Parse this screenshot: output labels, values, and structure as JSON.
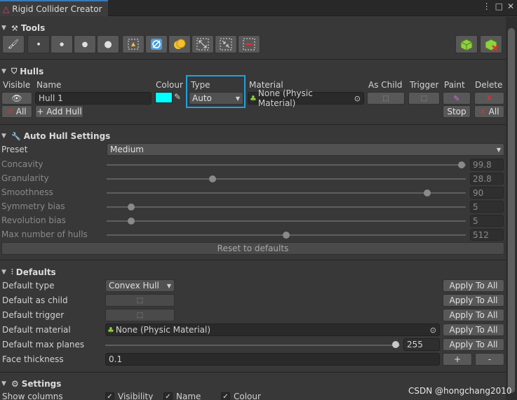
{
  "window": {
    "title": "Rigid Collider Creator",
    "menu_glyph": "⋮",
    "max_glyph": "□",
    "close_glyph": "✕"
  },
  "tools": {
    "title": "Tools"
  },
  "hulls": {
    "title": "Hulls",
    "columns": {
      "visible": "Visible",
      "name": "Name",
      "colour": "Colour",
      "type": "Type",
      "material": "Material",
      "as_child": "As Child",
      "trigger": "Trigger",
      "paint": "Paint",
      "delete": "Delete"
    },
    "row": {
      "name": "Hull 1",
      "colour": "#00ffff",
      "type": "Auto",
      "material": "None (Physic Material)"
    },
    "all_label": "All",
    "add_hull_label": "+ Add Hull",
    "stop_label": "Stop",
    "delete_all_label": "All"
  },
  "auto_hull": {
    "title": "Auto Hull Settings",
    "preset_label": "Preset",
    "preset_value": "Medium",
    "sliders": [
      {
        "label": "Concavity",
        "value": "99.8",
        "fraction": 0.998
      },
      {
        "label": "Granularity",
        "value": "28.8",
        "fraction": 0.29
      },
      {
        "label": "Smoothness",
        "value": "90",
        "fraction": 0.9
      },
      {
        "label": "Symmetry bias",
        "value": "5",
        "fraction": 0.06
      },
      {
        "label": "Revolution bias",
        "value": "5",
        "fraction": 0.06
      },
      {
        "label": "Max number of hulls",
        "value": "512",
        "fraction": 0.5
      }
    ],
    "reset_label": "Reset to defaults"
  },
  "defaults": {
    "title": "Defaults",
    "type_label": "Default type",
    "type_value": "Convex Hull",
    "as_child_label": "Default as child",
    "trigger_label": "Default trigger",
    "material_label": "Default material",
    "material_value": "None (Physic Material)",
    "max_planes_label": "Default max planes",
    "max_planes_value": "255",
    "max_planes_fraction": 0.998,
    "face_thickness_label": "Face thickness",
    "face_thickness_value": "0.1",
    "apply_label": "Apply To All",
    "plus_label": "+",
    "minus_label": "-"
  },
  "settings": {
    "title": "Settings",
    "show_columns_label": "Show columns",
    "columns": [
      "Visibility",
      "Name",
      "Colour"
    ]
  },
  "watermark": "CSDN @hongchang2010",
  "colors": {
    "accent": "#3a79bb",
    "highlight_border": "#1fa2e0",
    "cyan": "#00ffff",
    "red": "#e03030",
    "green": "#8fd13f",
    "yellow": "#f2c12e"
  }
}
